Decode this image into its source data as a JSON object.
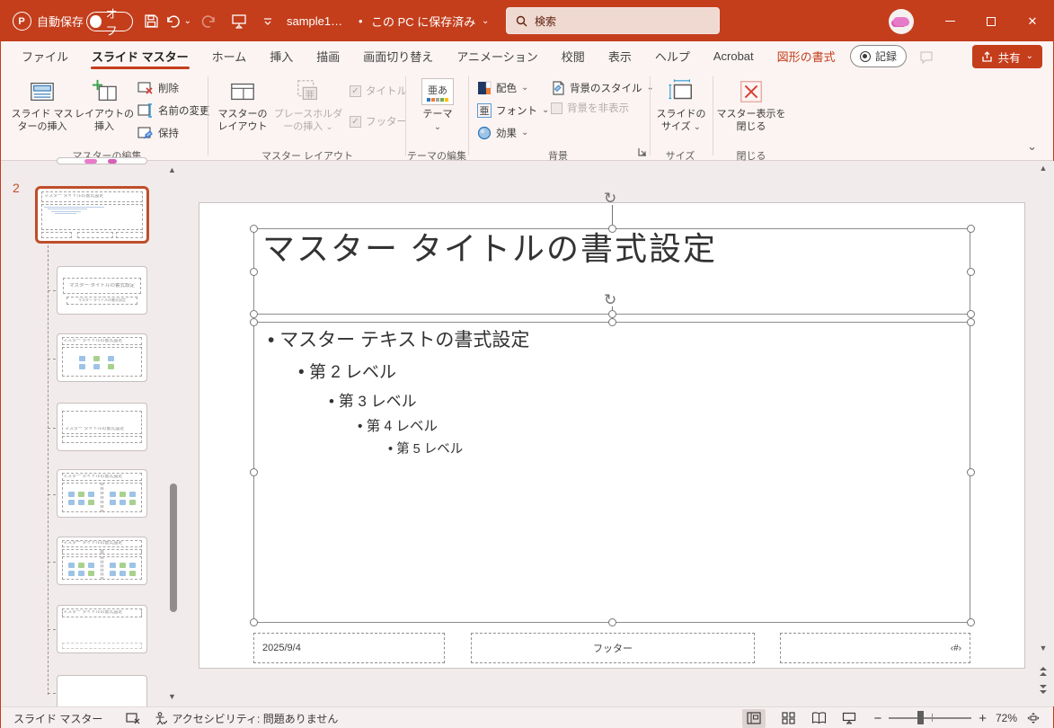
{
  "colors": {
    "titlebar": "#c43e1c",
    "accent": "#c43e1c",
    "selection_border": "#bf4e2b",
    "search_box": "#efd9d1"
  },
  "icons": {
    "chevron_down": "⌄",
    "check": "✓",
    "close": "✕",
    "rotate": "↻",
    "up_arrow": "▲",
    "down_arrow": "▼",
    "bullet": "•",
    "dialog_launcher": "⇲"
  },
  "titlebar": {
    "autosave_label": "自動保存",
    "autosave_state": "オフ",
    "filename": "sample1…",
    "save_location": "この PC に保存済み",
    "search_placeholder": "検索"
  },
  "tabs": [
    "ファイル",
    "スライド マスター",
    "ホーム",
    "挿入",
    "描画",
    "画面切り替え",
    "アニメーション",
    "校閲",
    "表示",
    "ヘルプ",
    "Acrobat",
    "図形の書式"
  ],
  "tabrow_controls": {
    "record": "記録",
    "share": "共有"
  },
  "ribbon": {
    "groups": [
      {
        "label": "マスターの編集",
        "buttons": [
          "スライド マスターの挿入",
          "レイアウトの挿入",
          "削除",
          "名前の変更",
          "保持"
        ]
      },
      {
        "label": "マスター レイアウト",
        "buttons": [
          "マスターのレイアウト",
          "プレースホルダーの挿入",
          "タイトル",
          "フッター"
        ]
      },
      {
        "label": "テーマの編集",
        "buttons": [
          "テーマ"
        ]
      },
      {
        "label": "背景",
        "buttons": [
          "配色",
          "フォント",
          "効果",
          "背景のスタイル",
          "背景を非表示"
        ]
      },
      {
        "label": "サイズ",
        "buttons": [
          "スライドのサイズ"
        ]
      },
      {
        "label": "閉じる",
        "buttons": [
          "マスター表示を閉じる"
        ]
      }
    ],
    "theme_icon_text": "亜あ",
    "font_icon_text": "亜"
  },
  "thumbnail_panel": {
    "selected_number": "2"
  },
  "slide": {
    "title": "マスター タイトルの書式設定",
    "body": [
      "マスター テキストの書式設定",
      "第 2 レベル",
      "第 3 レベル",
      "第 4 レベル",
      "第 5 レベル"
    ],
    "date": "2025/9/4",
    "footer": "フッター",
    "slide_number": "‹#›"
  },
  "statusbar": {
    "view_label": "スライド マスター",
    "accessibility": "アクセシビリティ: 問題ありません",
    "zoom_level": "72%"
  }
}
